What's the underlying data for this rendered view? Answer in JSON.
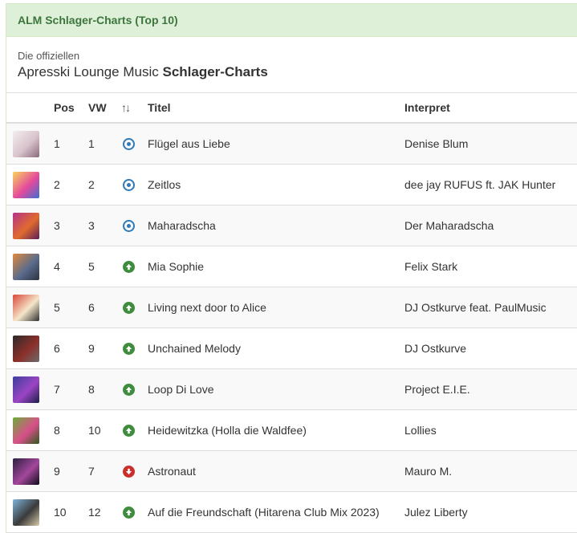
{
  "panel": {
    "title": "ALM Schlager-Charts (Top 10)",
    "intro_sub": "Die offiziellen",
    "intro_main": "Apresski Lounge Music ",
    "intro_bold": "Schlager-Charts"
  },
  "table": {
    "headers": {
      "pos": "Pos",
      "vw": "VW",
      "trend": "↑↓",
      "title": "Titel",
      "artist": "Interpret"
    },
    "rows": [
      {
        "pos": "1",
        "vw": "1",
        "trend": "same",
        "title": "Flügel aus Liebe",
        "artist": "Denise Blum",
        "cover": [
          "#f3eef0",
          "#d9c3cc",
          "#8a6a7a"
        ]
      },
      {
        "pos": "2",
        "vw": "2",
        "trend": "same",
        "title": "Zeitlos",
        "artist": "dee jay RUFUS ft. JAK Hunter",
        "cover": [
          "#f7d55b",
          "#e54a9d",
          "#3b6fd1"
        ]
      },
      {
        "pos": "3",
        "vw": "3",
        "trend": "same",
        "title": "Maharadscha",
        "artist": "Der Maharadscha",
        "cover": [
          "#b5338a",
          "#e06b2d",
          "#5b1d57"
        ]
      },
      {
        "pos": "4",
        "vw": "5",
        "trend": "up",
        "title": "Mia Sophie",
        "artist": "Felix Stark",
        "cover": [
          "#e08a3c",
          "#5a6b8c",
          "#2d3340"
        ]
      },
      {
        "pos": "5",
        "vw": "6",
        "trend": "up",
        "title": "Living next door to Alice",
        "artist": "DJ Ostkurve feat. PaulMusic",
        "cover": [
          "#d8473b",
          "#f5e6c9",
          "#2f2f2f"
        ]
      },
      {
        "pos": "6",
        "vw": "9",
        "trend": "up",
        "title": "Unchained Melody",
        "artist": "DJ Ostkurve",
        "cover": [
          "#2a2a2a",
          "#8c2f2a",
          "#6b6b6b"
        ]
      },
      {
        "pos": "7",
        "vw": "8",
        "trend": "up",
        "title": "Loop Di Love",
        "artist": "Project E.I.E.",
        "cover": [
          "#3a3f9c",
          "#9b45c4",
          "#1b1d4a"
        ]
      },
      {
        "pos": "8",
        "vw": "10",
        "trend": "up",
        "title": "Heidewitzka (Holla die Waldfee)",
        "artist": "Lollies",
        "cover": [
          "#6cae3a",
          "#d94f8a",
          "#2e5a1c"
        ]
      },
      {
        "pos": "9",
        "vw": "7",
        "trend": "down",
        "title": "Astronaut",
        "artist": "Mauro M.",
        "cover": [
          "#2b1f3f",
          "#a3479c",
          "#0f0c1a"
        ]
      },
      {
        "pos": "10",
        "vw": "12",
        "trend": "up",
        "title": "Auf die Freundschaft (Hitarena Club Mix 2023)",
        "artist": "Julez Liberty",
        "cover": [
          "#7fb3d9",
          "#3a3a3a",
          "#d8c9a8"
        ]
      }
    ]
  },
  "colors": {
    "heading_bg": "#dff0d8",
    "heading_text": "#3c763d",
    "trend_same": "#2f7ab9",
    "trend_up": "#3f8c3f",
    "trend_down": "#c9302c"
  }
}
